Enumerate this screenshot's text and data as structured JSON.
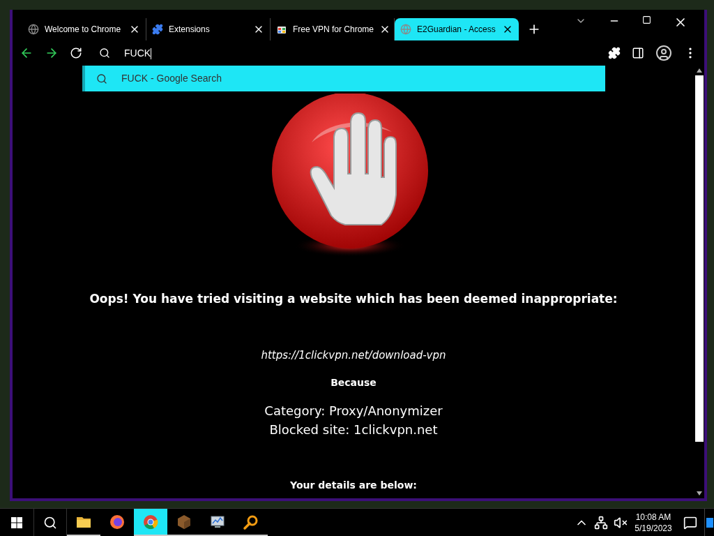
{
  "tabs": [
    {
      "title": "Welcome to Chrome",
      "kind": "globe",
      "selected": false
    },
    {
      "title": "Extensions",
      "kind": "puzzle",
      "selected": false
    },
    {
      "title": "Free VPN for Chrome",
      "kind": "store",
      "selected": false
    },
    {
      "title": "E2Guardian - Access",
      "kind": "globe",
      "selected": true
    }
  ],
  "toolbar": {
    "address": "FUCK"
  },
  "suggestion": {
    "text": "FUCK - Google Search"
  },
  "page": {
    "heading": "Oops! You have tried visiting a website which has been deemed inappropriate:",
    "url": "https://1clickvpn.net/download-vpn",
    "because": "Because",
    "category": "Category: Proxy/Anonymizer",
    "blocked": "Blocked site: 1clickvpn.net",
    "details": "Your details are below:"
  },
  "taskbar": {
    "apps": [
      {
        "kind": "folder",
        "selected": false,
        "running": true
      },
      {
        "kind": "firefox",
        "selected": false,
        "running": false
      },
      {
        "kind": "chrome",
        "selected": true,
        "running": true
      },
      {
        "kind": "block",
        "selected": false,
        "running": true
      },
      {
        "kind": "monitor",
        "selected": false,
        "running": true
      },
      {
        "kind": "magnifier",
        "selected": false,
        "running": true
      }
    ],
    "time": "10:08 AM",
    "date": "5/19/2023"
  }
}
